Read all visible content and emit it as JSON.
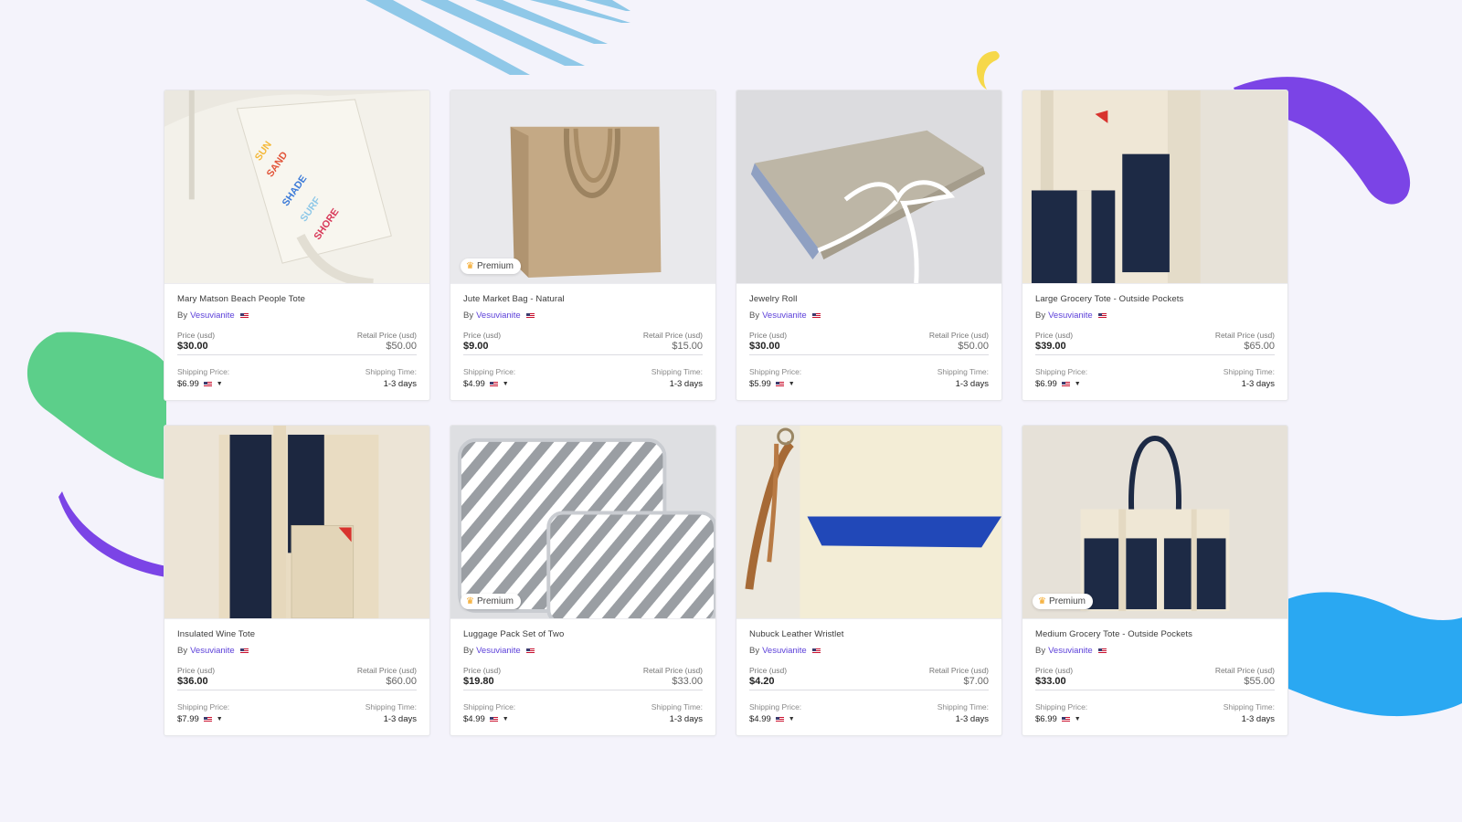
{
  "labels": {
    "by": "By",
    "price": "Price (usd)",
    "retail": "Retail Price (usd)",
    "shipping_price": "Shipping Price:",
    "shipping_time": "Shipping Time:",
    "premium": "Premium"
  },
  "colors": {
    "accent_purple": "#7b44e6",
    "accent_green": "#5ccf8a",
    "accent_blue": "#2aa8f2",
    "accent_yellow": "#f6d84a",
    "stripe_blue": "#8fc8e8",
    "vendor_link": "#5b3fd9"
  },
  "products": [
    {
      "title": "Mary Matson Beach People Tote",
      "vendor": "Vesuvianite",
      "price": "$30.00",
      "retail": "$50.00",
      "shipping": "$6.99",
      "time": "1-3 days",
      "premium": false,
      "image": "beach-tote-image",
      "image_text": [
        "SUN",
        "SAND",
        "SHADE",
        "SURF",
        "SHORE"
      ]
    },
    {
      "title": "Jute Market Bag - Natural",
      "vendor": "Vesuvianite",
      "price": "$9.00",
      "retail": "$15.00",
      "shipping": "$4.99",
      "time": "1-3 days",
      "premium": true,
      "image": "jute-bag-image"
    },
    {
      "title": "Jewelry Roll",
      "vendor": "Vesuvianite",
      "price": "$30.00",
      "retail": "$50.00",
      "shipping": "$5.99",
      "time": "1-3 days",
      "premium": false,
      "image": "jewelry-roll-image"
    },
    {
      "title": "Large Grocery Tote - Outside Pockets",
      "vendor": "Vesuvianite",
      "price": "$39.00",
      "retail": "$65.00",
      "shipping": "$6.99",
      "time": "1-3 days",
      "premium": false,
      "image": "grocery-tote-large-image"
    },
    {
      "title": "Insulated Wine Tote",
      "vendor": "Vesuvianite",
      "price": "$36.00",
      "retail": "$60.00",
      "shipping": "$7.99",
      "time": "1-3 days",
      "premium": false,
      "image": "wine-tote-image"
    },
    {
      "title": "Luggage Pack Set of Two",
      "vendor": "Vesuvianite",
      "price": "$19.80",
      "retail": "$33.00",
      "shipping": "$4.99",
      "time": "1-3 days",
      "premium": true,
      "image": "luggage-pack-image"
    },
    {
      "title": "Nubuck Leather Wristlet",
      "vendor": "Vesuvianite",
      "price": "$4.20",
      "retail": "$7.00",
      "shipping": "$4.99",
      "time": "1-3 days",
      "premium": false,
      "image": "wristlet-image"
    },
    {
      "title": "Medium Grocery Tote - Outside Pockets",
      "vendor": "Vesuvianite",
      "price": "$33.00",
      "retail": "$55.00",
      "shipping": "$6.99",
      "time": "1-3 days",
      "premium": true,
      "image": "grocery-tote-medium-image"
    }
  ]
}
